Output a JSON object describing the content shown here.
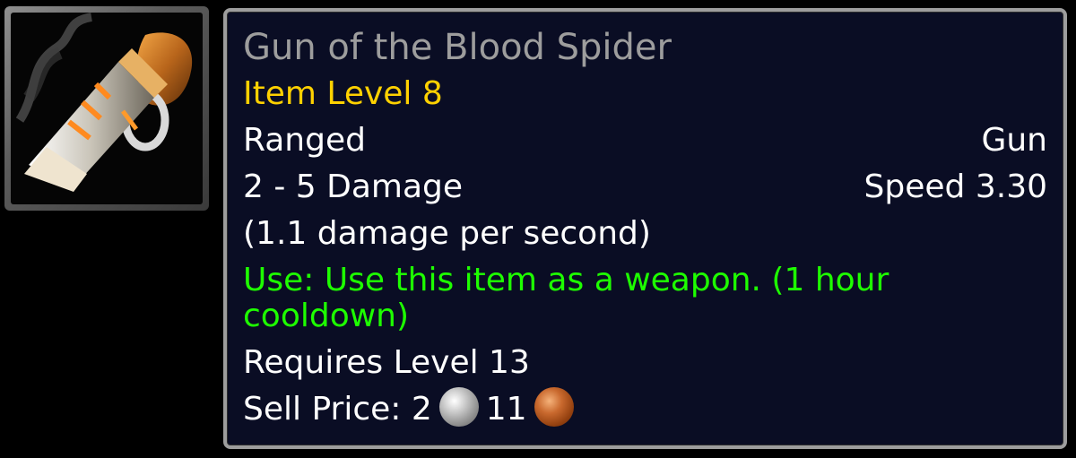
{
  "item": {
    "name": "Gun of the Blood Spider",
    "item_level": "Item Level 8",
    "slot": "Ranged",
    "weapon_type": "Gun",
    "damage": "2 - 5 Damage",
    "speed": "Speed 3.30",
    "dps": "(1.1 damage per second)",
    "use_effect": "Use: Use this item as a weapon. (1 hour cooldown)",
    "requirement": "Requires Level 13",
    "sell_price": {
      "label": "Sell Price:",
      "silver": "2",
      "copper": "11"
    },
    "icon": "gun-icon"
  },
  "colors": {
    "poor_quality": "#9d9d9d",
    "item_level": "#ffd100",
    "use_effect": "#1eff00",
    "text": "#ffffff",
    "tooltip_background": "#0a0d24",
    "tooltip_border": "#9d9d9d"
  }
}
